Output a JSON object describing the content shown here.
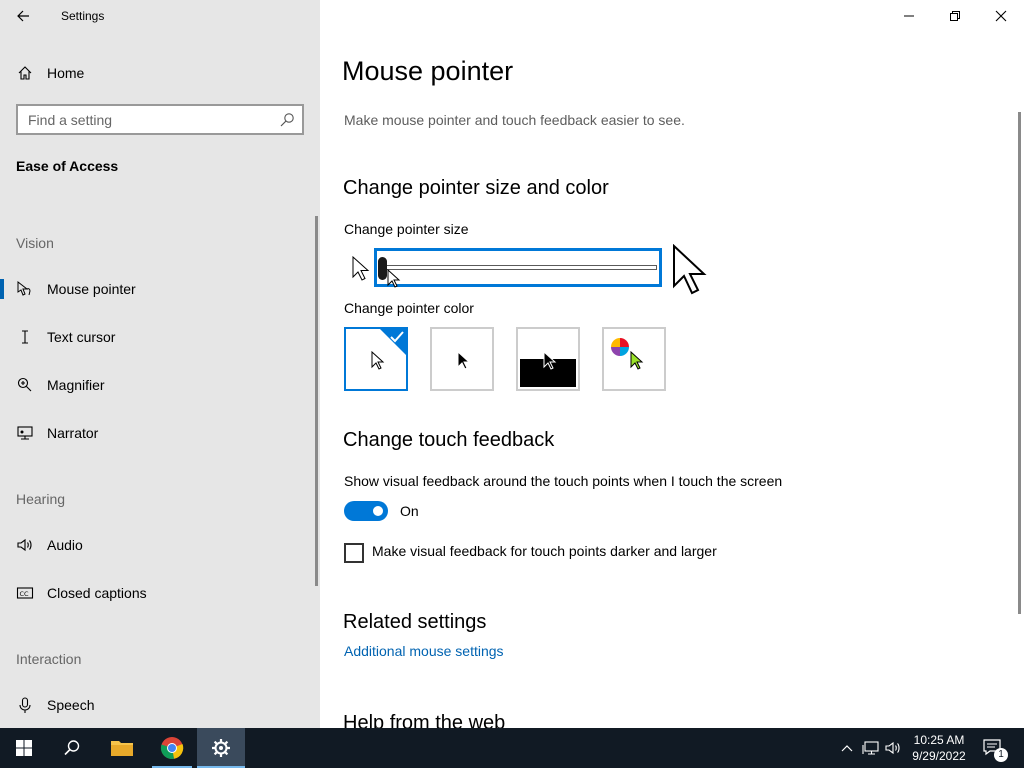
{
  "window": {
    "title": "Settings"
  },
  "sidebar": {
    "home_label": "Home",
    "search_placeholder": "Find a setting",
    "section_title": "Ease of Access",
    "groups": {
      "vision": "Vision",
      "hearing": "Hearing",
      "interaction": "Interaction"
    },
    "items": [
      {
        "label": "Mouse pointer",
        "icon": "mouse-pointer-icon",
        "active": true
      },
      {
        "label": "Text cursor",
        "icon": "text-cursor-icon"
      },
      {
        "label": "Magnifier",
        "icon": "magnifier-icon"
      },
      {
        "label": "Narrator",
        "icon": "narrator-icon"
      },
      {
        "label": "Audio",
        "icon": "speaker-icon"
      },
      {
        "label": "Closed captions",
        "icon": "closed-captions-icon"
      },
      {
        "label": "Speech",
        "icon": "microphone-icon"
      }
    ]
  },
  "main": {
    "title": "Mouse pointer",
    "description": "Make mouse pointer and touch feedback easier to see.",
    "pointer_section": "Change pointer size and color",
    "size_label": "Change pointer size",
    "size_value": 1,
    "color_label": "Change pointer color",
    "color_options": [
      "white",
      "black",
      "inverted",
      "custom"
    ],
    "color_selected": "white",
    "touch_section": "Change touch feedback",
    "touch_desc": "Show visual feedback around the touch points when I touch the screen",
    "toggle_state": "On",
    "checkbox_label": "Make visual feedback for touch points darker and larger",
    "related_section": "Related settings",
    "related_link": "Additional mouse settings",
    "help_section": "Help from the web"
  },
  "taskbar": {
    "time": "10:25 AM",
    "date": "9/29/2022",
    "notification_count": "1"
  },
  "colors": {
    "accent": "#0078d7",
    "sidebar_bg": "#e6e6e6",
    "taskbar_bg": "#111a24",
    "link": "#0063b1"
  }
}
